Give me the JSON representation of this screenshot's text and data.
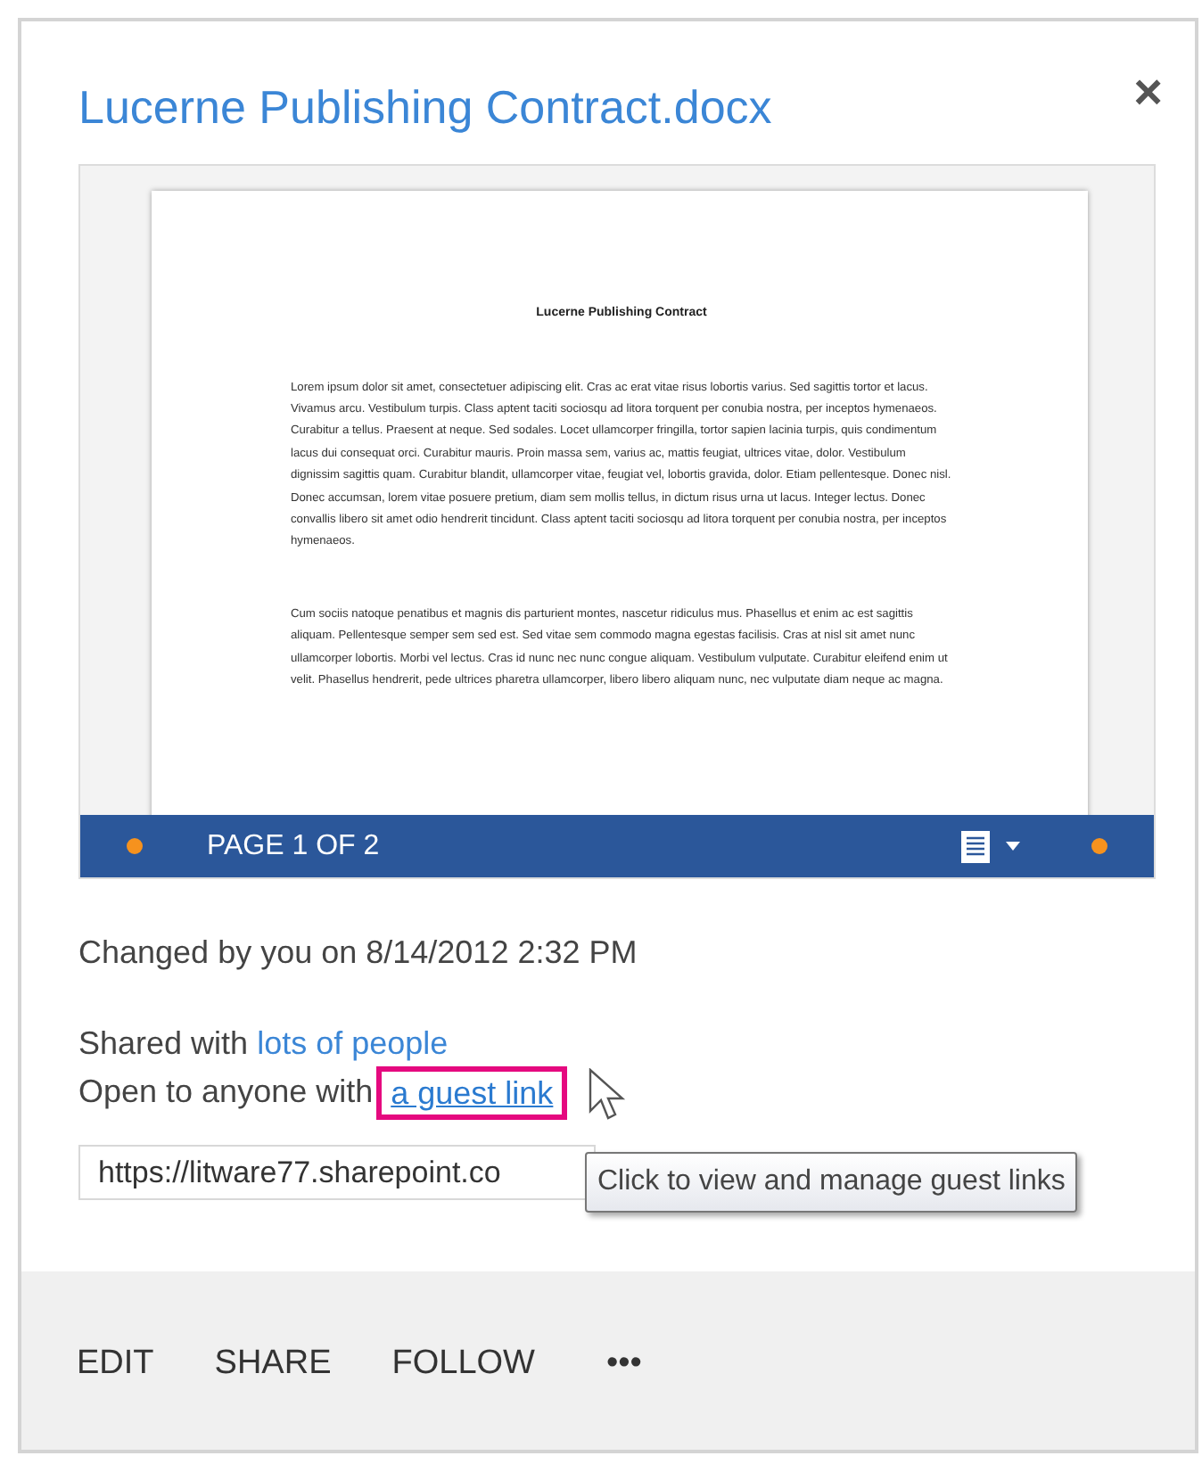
{
  "dialog": {
    "title": "Lucerne Publishing Contract.docx",
    "close": "×"
  },
  "preview": {
    "document_title": "Lucerne Publishing Contract",
    "paragraphs": [
      "Lorem ipsum dolor sit amet, consectetuer adipiscing elit. Cras ac erat vitae risus lobortis varius. Sed sagittis tortor et lacus. Vivamus arcu. Vestibulum turpis. Class aptent taciti sociosqu ad litora torquent per conubia nostra, per inceptos hymenaeos. Curabitur a tellus. Praesent at neque. Sed sodales. Locet ullamcorper fringilla, tortor sapien lacinia turpis, quis condimentum lacus dui consequat orci. Curabitur mauris. Proin massa sem, varius ac, mattis feugiat, ultrices vitae, dolor. Vestibulum dignissim sagittis quam. Curabitur blandit, ullamcorper vitae, feugiat vel, lobortis gravida, dolor. Etiam pellentesque. Donec nisl. Donec accumsan, lorem vitae posuere pretium, diam sem mollis tellus, in dictum risus urna ut lacus. Integer lectus. Donec convallis libero sit amet odio hendrerit tincidunt. Class aptent taciti sociosqu ad litora torquent per conubia nostra, per inceptos hymenaeos.",
      "Cum sociis natoque penatibus et magnis dis parturient montes, nascetur ridiculus mus. Phasellus et enim ac est sagittis aliquam. Pellentesque semper sem sed est. Sed vitae sem commodo magna egestas facilisis. Cras at nisl sit amet nunc ullamcorper lobortis. Morbi vel lectus. Cras id nunc nec nunc congue aliquam. Vestibulum vulputate. Curabitur eleifend enim ut velit. Phasellus hendrerit, pede ultrices pharetra ullamcorper, libero libero aliquam nunc, nec vulputate diam neque ac magna."
    ],
    "page_indicator": "PAGE 1 OF 2"
  },
  "changed": "Changed by you on 8/14/2012 2:32 PM",
  "shared": {
    "label": "Shared with",
    "link": "lots of people"
  },
  "open": {
    "label": "Open to anyone with",
    "link": "a guest link",
    "highlighted": true
  },
  "guest_url": {
    "value": "https://litware77.sharepoint.co"
  },
  "tooltip": "Click to view and manage guest links",
  "actions": [
    "EDIT",
    "SHARE",
    "FOLLOW",
    "•••"
  ]
}
